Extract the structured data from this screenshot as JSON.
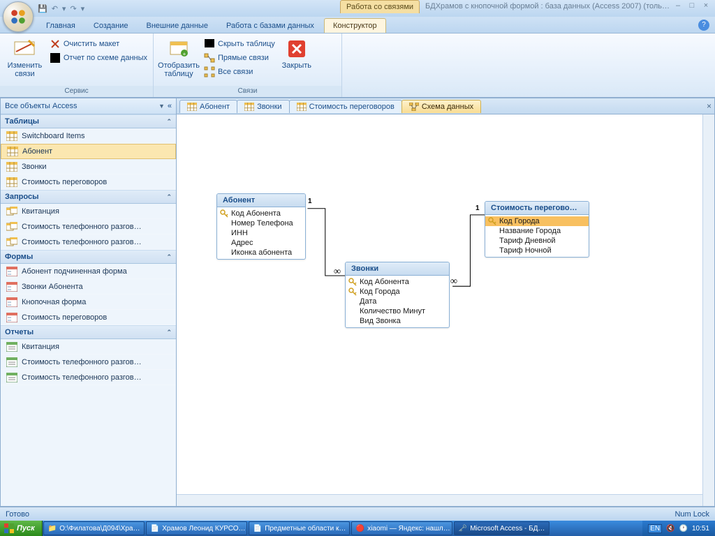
{
  "title_context": "Работа со связями",
  "title_text": "БДХрамов с кнопочной формой : база данных (Access 2007) (толь…",
  "qat": {
    "save": "💾",
    "undo": "↶",
    "redo": "↷"
  },
  "ribbon_tabs": [
    "Главная",
    "Создание",
    "Внешние данные",
    "Работа с базами данных",
    "Конструктор"
  ],
  "ribbon": {
    "group1": {
      "label": "Сервис",
      "edit_rel": "Изменить\nсвязи",
      "clear": "Очистить макет",
      "report": "Отчет по схеме данных"
    },
    "group2": {
      "label": "Связи",
      "show_table": "Отобразить\nтаблицу",
      "hide_table": "Скрыть таблицу",
      "direct": "Прямые связи",
      "all": "Все связи",
      "close": "Закрыть"
    }
  },
  "nav": {
    "header": "Все объекты Access",
    "cats": {
      "tables": {
        "label": "Таблицы",
        "items": [
          "Switchboard Items",
          "Абонент",
          "Звонки",
          "Стоимость переговоров"
        ]
      },
      "queries": {
        "label": "Запросы",
        "items": [
          "Квитанция",
          "Стоимость телефонного разгов…",
          "Стоимость телефонного разгов…"
        ]
      },
      "forms": {
        "label": "Формы",
        "items": [
          "Абонент подчиненная форма",
          "Звонки Абонента",
          "Кнопочная форма",
          "Стоимость переговоров"
        ]
      },
      "reports": {
        "label": "Отчеты",
        "items": [
          "Квитанция",
          "Стоимость телефонного разгов…",
          "Стоимость телефонного разгов…"
        ]
      }
    }
  },
  "doc_tabs": [
    {
      "label": "Абонент",
      "active": false
    },
    {
      "label": "Звонки",
      "active": false
    },
    {
      "label": "Стоимость переговоров",
      "active": false
    },
    {
      "label": "Схема данных",
      "active": true
    }
  ],
  "entities": {
    "abonent": {
      "title": "Абонент",
      "fields": [
        {
          "name": "Код Абонента",
          "key": true
        },
        {
          "name": "Номер Телефона"
        },
        {
          "name": "ИНН"
        },
        {
          "name": "Адрес"
        },
        {
          "name": "Иконка абонента"
        }
      ]
    },
    "zvonki": {
      "title": "Звонки",
      "fields": [
        {
          "name": "Код Абонента",
          "key": true
        },
        {
          "name": "Код Города",
          "key": true
        },
        {
          "name": "Дата"
        },
        {
          "name": "Количество Минут"
        },
        {
          "name": "Вид Звонка"
        }
      ]
    },
    "stoimost": {
      "title": "Стоимость перегово…",
      "fields": [
        {
          "name": "Код Города",
          "key": true,
          "selected": true
        },
        {
          "name": "Название Города"
        },
        {
          "name": "Тариф Дневной"
        },
        {
          "name": "Тариф Ночной"
        }
      ]
    }
  },
  "rel": {
    "one": "1",
    "many": "∞"
  },
  "status": {
    "left": "Готово",
    "right": "Num Lock"
  },
  "taskbar": {
    "start": "Пуск",
    "items": [
      "O:\\Филатова\\Д094\\Хра…",
      "Храмов Леонид КУРСО…",
      "Предметные области к…",
      "xiaomi — Яндекс: нашл…",
      "Microsoft Access - БД…"
    ],
    "lang": "EN",
    "time": "10:51"
  }
}
